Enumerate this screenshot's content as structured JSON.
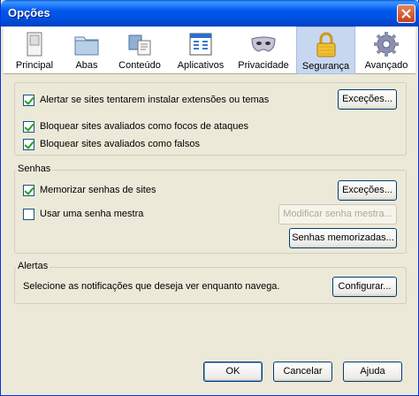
{
  "window": {
    "title": "Opções"
  },
  "tabs": [
    {
      "label": "Principal",
      "icon": "switch-icon"
    },
    {
      "label": "Abas",
      "icon": "folder-tabs-icon"
    },
    {
      "label": "Conteúdo",
      "icon": "content-icon"
    },
    {
      "label": "Aplicativos",
      "icon": "applications-icon"
    },
    {
      "label": "Privacidade",
      "icon": "mask-icon"
    },
    {
      "label": "Segurança",
      "icon": "padlock-icon",
      "selected": true
    },
    {
      "label": "Avançado",
      "icon": "gear-icon"
    }
  ],
  "general": {
    "warn_addons": {
      "label": "Alertar se sites tentarem instalar extensões ou temas",
      "checked": true
    },
    "exceptions_button": "Exceções...",
    "block_attack": {
      "label": "Bloquear sites avaliados como focos de ataques",
      "checked": true
    },
    "block_forgery": {
      "label": "Bloquear sites avaliados como falsos",
      "checked": true
    }
  },
  "passwords": {
    "title": "Senhas",
    "remember": {
      "label": "Memorizar senhas de sites",
      "checked": true
    },
    "exceptions_button": "Exceções...",
    "master": {
      "label": "Usar uma senha mestra",
      "checked": false
    },
    "change_master_button": "Modificar senha mestra...",
    "saved_button": "Senhas memorizadas..."
  },
  "warnings": {
    "title": "Alertas",
    "description": "Selecione as notificações que deseja ver enquanto navega.",
    "settings_button": "Configurar..."
  },
  "footer": {
    "ok": "OK",
    "cancel": "Cancelar",
    "help": "Ajuda"
  },
  "colors": {
    "titlebar": "#0058ee",
    "dialog_bg": "#ece9d8",
    "selected_tab": "#c7d7f0",
    "check": "#21a121"
  }
}
